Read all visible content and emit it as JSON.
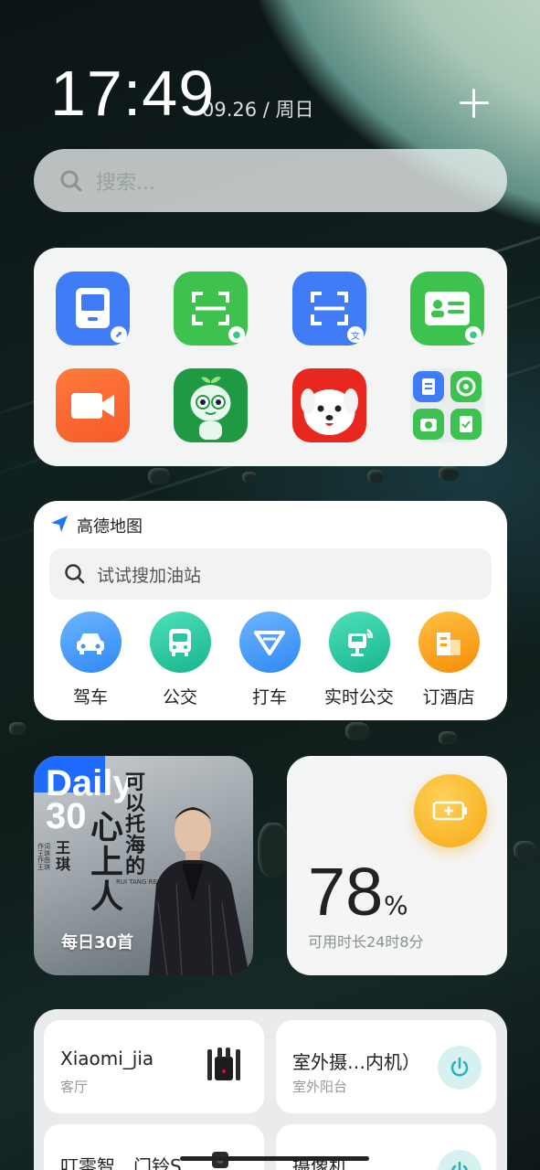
{
  "status": {
    "time": "17:49",
    "date": "09.26 / 周日"
  },
  "search": {
    "placeholder": "搜索..."
  },
  "app_grid": {
    "apps": [
      {
        "name": "transit-card",
        "color": "#3f7cf5"
      },
      {
        "name": "wechat-scan",
        "color": "#3ec24f"
      },
      {
        "name": "scan-translate",
        "color": "#3f7cf5"
      },
      {
        "name": "wechat-id-card",
        "color": "#3ec24f"
      },
      {
        "name": "video-call",
        "color": "#fd6b33"
      },
      {
        "name": "robot-assistant",
        "color": "#1f9a42"
      },
      {
        "name": "jd-dog",
        "color": "#e8271e"
      },
      {
        "name": "app-folder",
        "color": "#e8ecec"
      }
    ]
  },
  "map_widget": {
    "title": "高德地图",
    "search_placeholder": "试试搜加油站",
    "actions": [
      {
        "label": "驾车",
        "icon": "car-icon",
        "color": "#3f9bf8"
      },
      {
        "label": "公交",
        "icon": "bus-icon",
        "color": "#25c8a0"
      },
      {
        "label": "打车",
        "icon": "taxi-icon",
        "color": "#3f9bf8"
      },
      {
        "label": "实时公交",
        "icon": "realtime-bus-icon",
        "color": "#25c8a0"
      },
      {
        "label": "订酒店",
        "icon": "hotel-icon",
        "color": "#f9a41c"
      }
    ]
  },
  "daily_widget": {
    "logo": "Daily 30",
    "caption": "每日30首",
    "cover_title_1": "可以托海的",
    "cover_title_2": "心上人",
    "cover_artist": "王琪",
    "cover_credit": "作词 王琪 作曲 王琪",
    "cover_romanized": "RUI TANG REN"
  },
  "battery_widget": {
    "value": "78",
    "unit": "%",
    "subtitle": "可用时长24时8分"
  },
  "smart_home": {
    "devices": [
      {
        "name": "Xiaomi_jia",
        "room": "客厅",
        "type": "router"
      },
      {
        "name": "室外摄…内机）",
        "room": "室外阳台",
        "type": "power"
      },
      {
        "name": "叮零智…门铃S",
        "room": "",
        "type": "camera"
      },
      {
        "name": "摄像机",
        "room": "",
        "type": "power"
      }
    ]
  }
}
